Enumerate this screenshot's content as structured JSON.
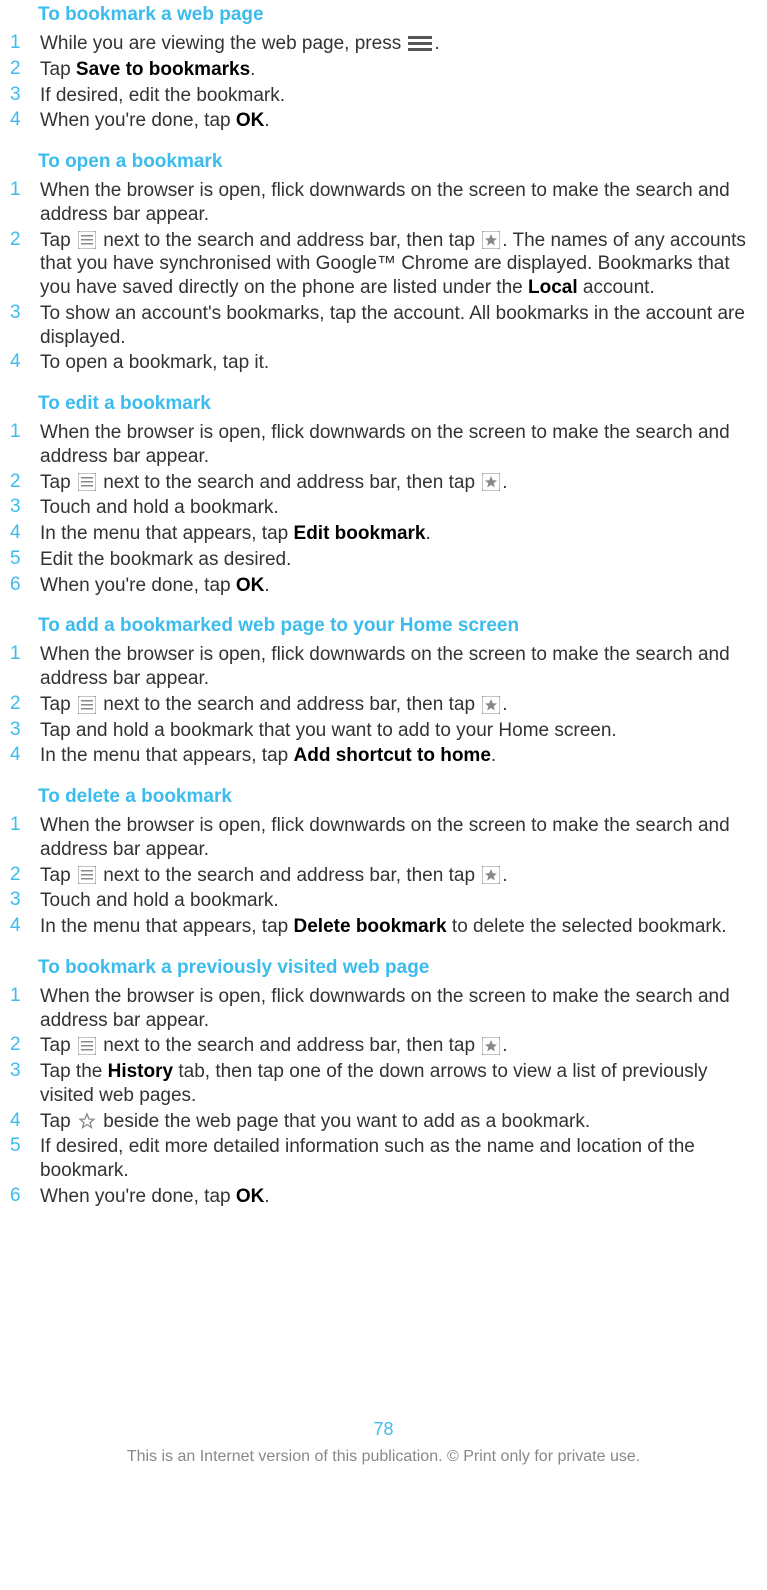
{
  "sections": [
    {
      "title": "To bookmark a web page",
      "steps": [
        {
          "n": "1",
          "parts": [
            {
              "t": "text",
              "v": "While you are viewing the web page, press "
            },
            {
              "t": "icon",
              "v": "menu-icon"
            },
            {
              "t": "text",
              "v": "."
            }
          ]
        },
        {
          "n": "2",
          "parts": [
            {
              "t": "text",
              "v": "Tap "
            },
            {
              "t": "bold",
              "v": "Save to bookmarks"
            },
            {
              "t": "text",
              "v": "."
            }
          ]
        },
        {
          "n": "3",
          "parts": [
            {
              "t": "text",
              "v": "If desired, edit the bookmark."
            }
          ]
        },
        {
          "n": "4",
          "parts": [
            {
              "t": "text",
              "v": "When you're done, tap "
            },
            {
              "t": "bold",
              "v": "OK"
            },
            {
              "t": "text",
              "v": "."
            }
          ]
        }
      ]
    },
    {
      "title": "To open a bookmark",
      "steps": [
        {
          "n": "1",
          "parts": [
            {
              "t": "text",
              "v": "When the browser is open, flick downwards on the screen to make the search and address bar appear."
            }
          ]
        },
        {
          "n": "2",
          "parts": [
            {
              "t": "text",
              "v": "Tap "
            },
            {
              "t": "icon",
              "v": "list-icon"
            },
            {
              "t": "text",
              "v": " next to the search and address bar, then tap "
            },
            {
              "t": "icon",
              "v": "star-icon"
            },
            {
              "t": "text",
              "v": ". The names of any accounts that you have synchronised with Google™ Chrome are displayed. Bookmarks that you have saved directly on the phone are listed under the "
            },
            {
              "t": "bold",
              "v": "Local"
            },
            {
              "t": "text",
              "v": " account."
            }
          ]
        },
        {
          "n": "3",
          "parts": [
            {
              "t": "text",
              "v": "To show an account's bookmarks, tap the account. All bookmarks in the account are displayed."
            }
          ]
        },
        {
          "n": "4",
          "parts": [
            {
              "t": "text",
              "v": "To open a bookmark, tap it."
            }
          ]
        }
      ]
    },
    {
      "title": "To edit a bookmark",
      "steps": [
        {
          "n": "1",
          "parts": [
            {
              "t": "text",
              "v": "When the browser is open, flick downwards on the screen to make the search and address bar appear."
            }
          ]
        },
        {
          "n": "2",
          "parts": [
            {
              "t": "text",
              "v": "Tap "
            },
            {
              "t": "icon",
              "v": "list-icon"
            },
            {
              "t": "text",
              "v": " next to the search and address bar, then tap "
            },
            {
              "t": "icon",
              "v": "star-icon"
            },
            {
              "t": "text",
              "v": "."
            }
          ]
        },
        {
          "n": "3",
          "parts": [
            {
              "t": "text",
              "v": "Touch and hold a bookmark."
            }
          ]
        },
        {
          "n": "4",
          "parts": [
            {
              "t": "text",
              "v": "In the menu that appears, tap "
            },
            {
              "t": "bold",
              "v": "Edit bookmark"
            },
            {
              "t": "text",
              "v": "."
            }
          ]
        },
        {
          "n": "5",
          "parts": [
            {
              "t": "text",
              "v": "Edit the bookmark as desired."
            }
          ]
        },
        {
          "n": "6",
          "parts": [
            {
              "t": "text",
              "v": "When you're done, tap "
            },
            {
              "t": "bold",
              "v": "OK"
            },
            {
              "t": "text",
              "v": "."
            }
          ]
        }
      ]
    },
    {
      "title": "To add a bookmarked web page to your Home screen",
      "steps": [
        {
          "n": "1",
          "parts": [
            {
              "t": "text",
              "v": "When the browser is open, flick downwards on the screen to make the search and address bar appear."
            }
          ]
        },
        {
          "n": "2",
          "parts": [
            {
              "t": "text",
              "v": "Tap "
            },
            {
              "t": "icon",
              "v": "list-icon"
            },
            {
              "t": "text",
              "v": " next to the search and address bar, then tap "
            },
            {
              "t": "icon",
              "v": "star-icon"
            },
            {
              "t": "text",
              "v": "."
            }
          ]
        },
        {
          "n": "3",
          "parts": [
            {
              "t": "text",
              "v": "Tap and hold a bookmark that you want to add to your Home screen."
            }
          ]
        },
        {
          "n": "4",
          "parts": [
            {
              "t": "text",
              "v": "In the menu that appears, tap "
            },
            {
              "t": "bold",
              "v": "Add shortcut to home"
            },
            {
              "t": "text",
              "v": "."
            }
          ]
        }
      ]
    },
    {
      "title": "To delete a bookmark",
      "steps": [
        {
          "n": "1",
          "parts": [
            {
              "t": "text",
              "v": "When the browser is open, flick downwards on the screen to make the search and address bar appear."
            }
          ]
        },
        {
          "n": "2",
          "parts": [
            {
              "t": "text",
              "v": "Tap "
            },
            {
              "t": "icon",
              "v": "list-icon"
            },
            {
              "t": "text",
              "v": " next to the search and address bar, then tap "
            },
            {
              "t": "icon",
              "v": "star-icon"
            },
            {
              "t": "text",
              "v": "."
            }
          ]
        },
        {
          "n": "3",
          "parts": [
            {
              "t": "text",
              "v": "Touch and hold a bookmark."
            }
          ]
        },
        {
          "n": "4",
          "parts": [
            {
              "t": "text",
              "v": "In the menu that appears, tap "
            },
            {
              "t": "bold",
              "v": "Delete bookmark"
            },
            {
              "t": "text",
              "v": " to delete the selected bookmark."
            }
          ]
        }
      ]
    },
    {
      "title": "To bookmark a previously visited web page",
      "steps": [
        {
          "n": "1",
          "parts": [
            {
              "t": "text",
              "v": "When the browser is open, flick downwards on the screen to make the search and address bar appear."
            }
          ]
        },
        {
          "n": "2",
          "parts": [
            {
              "t": "text",
              "v": "Tap "
            },
            {
              "t": "icon",
              "v": "list-icon"
            },
            {
              "t": "text",
              "v": " next to the search and address bar, then tap "
            },
            {
              "t": "icon",
              "v": "star-icon"
            },
            {
              "t": "text",
              "v": "."
            }
          ]
        },
        {
          "n": "3",
          "parts": [
            {
              "t": "text",
              "v": "Tap the "
            },
            {
              "t": "bold",
              "v": "History"
            },
            {
              "t": "text",
              "v": " tab, then tap one of the down arrows to view a list of previously visited web pages."
            }
          ]
        },
        {
          "n": "4",
          "parts": [
            {
              "t": "text",
              "v": "Tap "
            },
            {
              "t": "icon",
              "v": "star-outline-icon"
            },
            {
              "t": "text",
              "v": " beside the web page that you want to add as a bookmark."
            }
          ]
        },
        {
          "n": "5",
          "parts": [
            {
              "t": "text",
              "v": "If desired, edit more detailed information such as the name and location of the bookmark."
            }
          ]
        },
        {
          "n": "6",
          "parts": [
            {
              "t": "text",
              "v": "When you're done, tap "
            },
            {
              "t": "bold",
              "v": "OK"
            },
            {
              "t": "text",
              "v": "."
            }
          ]
        }
      ]
    }
  ],
  "page_number": "78",
  "footer": "This is an Internet version of this publication. © Print only for private use."
}
